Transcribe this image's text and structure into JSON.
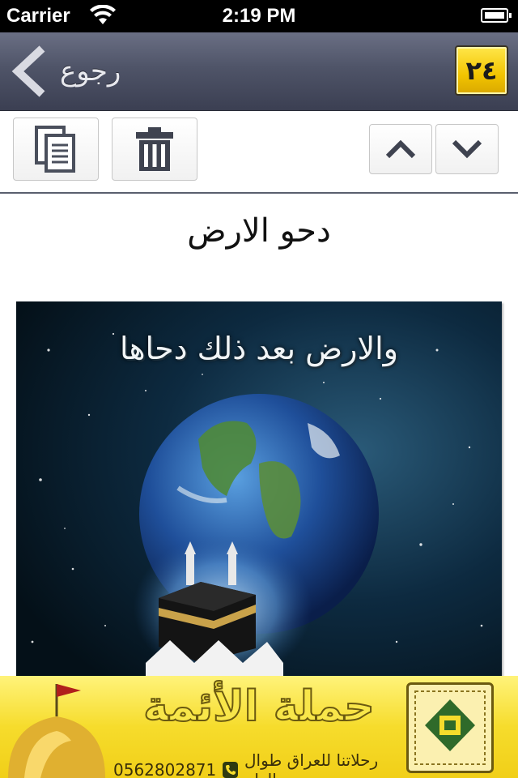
{
  "status_bar": {
    "carrier": "Carrier",
    "time": "2:19 PM"
  },
  "nav": {
    "back_label": "رجوع",
    "logo_text": "٢٤"
  },
  "toolbar": {
    "copy_icon": "copy-icon",
    "delete_icon": "trash-icon",
    "up_icon": "chevron-up-icon",
    "down_icon": "chevron-down-icon"
  },
  "article": {
    "title": "دحو الارض",
    "image_caption": "والارض بعد ذلك دحاها"
  },
  "ad": {
    "title": "حملة الأئمة",
    "subtitle": "رحلاتنا للعراق طوال العام",
    "phone": "0562802871"
  },
  "colors": {
    "nav_bar": "#4f5468",
    "status_bar": "#000000",
    "ad_background": "#f6dc2c"
  }
}
